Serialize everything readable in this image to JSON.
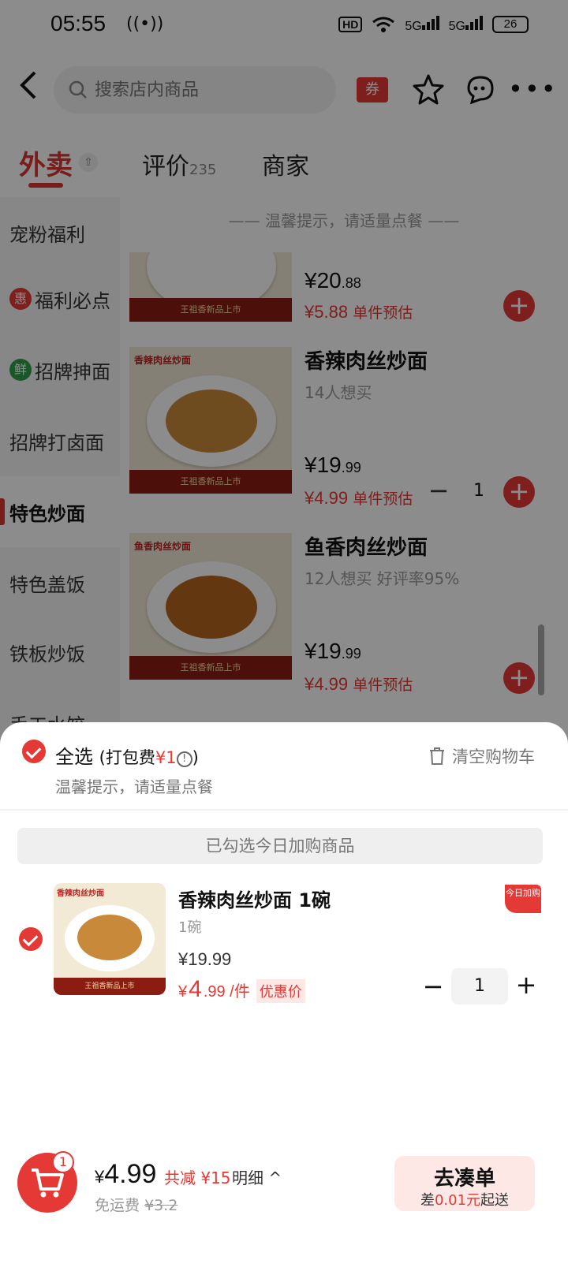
{
  "status": {
    "time": "05:55",
    "hd": "HD",
    "net1": "5G",
    "net2": "5G",
    "battery": "26"
  },
  "header": {
    "search_placeholder": "搜索店内商品",
    "coupon": "券"
  },
  "tabs": {
    "active": "外卖",
    "reviews": "评价",
    "reviews_count": "235",
    "merchant": "商家"
  },
  "sidebar": {
    "items": [
      {
        "label": "宠粉福利",
        "badge": ""
      },
      {
        "label": "福利必点",
        "badge": "惠",
        "badge_color": "#e53935"
      },
      {
        "label": "招牌抻面",
        "badge": "鲜",
        "badge_color": "#2e9e4a"
      },
      {
        "label": "招牌打卤面",
        "badge": ""
      },
      {
        "label": "特色炒面",
        "badge": ""
      },
      {
        "label": "特色盖饭",
        "badge": ""
      },
      {
        "label": "铁板炒饭",
        "badge": ""
      },
      {
        "label": "手工水饺",
        "badge": ""
      }
    ]
  },
  "menu": {
    "tip": "温馨提示，请适量点餐",
    "dishes": [
      {
        "name": "",
        "sub": "",
        "price_int": "¥20",
        "price_dec": ".88",
        "deal": "¥5.88",
        "deal_label": "单件预估",
        "banner": "王祖香新品上市"
      },
      {
        "name": "香辣肉丝炒面",
        "sub": "14人想买",
        "price_int": "¥19",
        "price_dec": ".99",
        "deal": "¥4.99",
        "deal_label": "单件预估",
        "qty": "1",
        "caption": "香辣肉丝炒面",
        "banner": "王祖香新品上市"
      },
      {
        "name": "鱼香肉丝炒面",
        "sub": "12人想买  好评率95%",
        "price_int": "¥19",
        "price_dec": ".99",
        "deal": "¥4.99",
        "deal_label": "单件预估",
        "caption": "鱼香肉丝炒面",
        "banner": "王祖香新品上市"
      }
    ]
  },
  "cart": {
    "select_all": "全选",
    "pack_fee_prefix": "(打包费",
    "pack_fee_value": "¥1",
    "pack_fee_suffix": ")",
    "clear": "清空购物车",
    "tip": "温馨提示，请适量点餐",
    "section": "已勾选今日加购商品",
    "item": {
      "name": "香辣肉丝炒面 1碗",
      "spec": "1碗",
      "orig_price": "¥19.99",
      "deal_sym": "¥",
      "deal_big": "4",
      "deal_rest": ".99 /件",
      "deal_tag": "优惠价",
      "today_tag": "今日加购",
      "qty": "1",
      "caption": "香辣肉丝炒面",
      "banner": "王祖香新品上市"
    }
  },
  "footer": {
    "badge": "1",
    "total_sym": "¥",
    "total": "4.99",
    "saved": "共减 ¥15",
    "detail": "明细 ^",
    "delivery_label": "免运费",
    "delivery_orig": "¥3.2",
    "checkout": "去凑单",
    "checkout_sub_prefix": "差",
    "checkout_sub_value": "0.01元",
    "checkout_sub_suffix": "起送"
  },
  "colors": {
    "accent": "#e53935",
    "deal_bg": "#fde8e6"
  }
}
